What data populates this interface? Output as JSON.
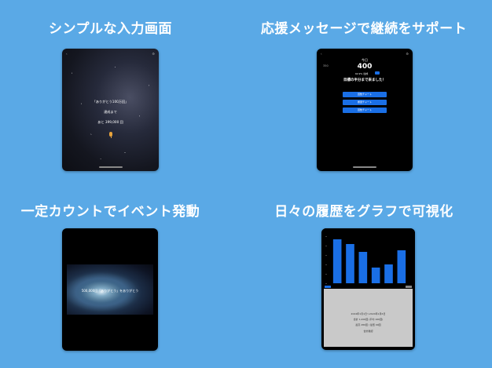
{
  "panels": [
    {
      "caption": "シンプルな入力画面",
      "screen": {
        "line1": "「ありがとう100万回」",
        "line2": "達成まで",
        "line3": "あと 399,000 回"
      }
    },
    {
      "caption": "応援メッセージで継続をサポート",
      "screen": {
        "today_label": "今日",
        "today_value": "400",
        "total_value": "350",
        "percent_text": "42.9% 達成",
        "message": "目標の半分まで来ました！",
        "buttons": [
          "回数チャート",
          "履歴チャート",
          "回数チャート"
        ]
      }
    },
    {
      "caption": "一定カウントでイベント発動",
      "screen": {
        "event_text": "500,000回「ありがとう」をありがとう"
      }
    },
    {
      "caption": "日々の履歴をグラフで可視化",
      "screen": {
        "info_lines": [
          "2024年1月1日〜2024年1月6日",
          "合計 1,000回 (平均 166回)",
          "最高 280回 / 最低 90回",
          "合計確認"
        ]
      }
    }
  ],
  "chart_data": {
    "type": "bar",
    "categories": [
      "1",
      "2",
      "3",
      "4",
      "5",
      "6"
    ],
    "values": [
      280,
      250,
      200,
      100,
      120,
      210
    ],
    "ylim": [
      0,
      300
    ]
  },
  "colors": {
    "background": "#5aa9e6",
    "accent_blue": "#1a6fe6",
    "mic_orange": "#e8a33c",
    "info_gray": "#c9c9c9"
  }
}
